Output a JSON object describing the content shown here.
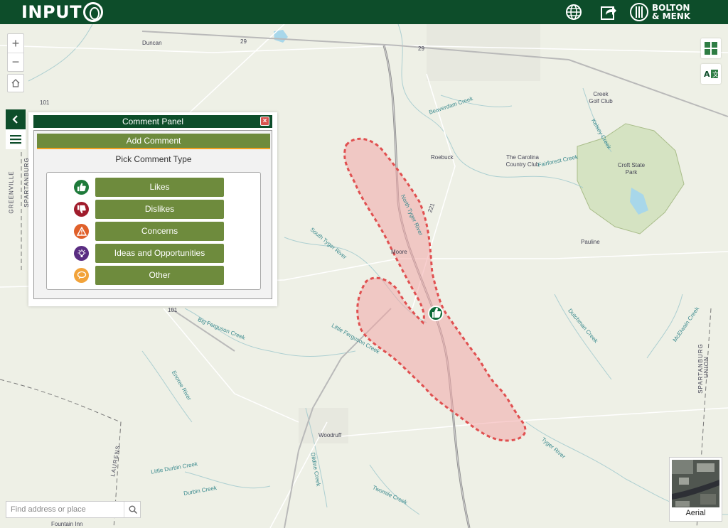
{
  "header": {
    "brand": "INPUT",
    "brand_suffix": "iD",
    "language_icon": "globe-icon",
    "share_icon": "share-icon",
    "company_line1": "BOLTON",
    "company_line2": "& MENK",
    "colors": {
      "header_bg": "#0d4d2a",
      "button_green": "#6e8b3d",
      "accent_orange": "#f0a020"
    }
  },
  "map": {
    "places": [
      {
        "label": "Duncan"
      },
      {
        "label": "Roebuck"
      },
      {
        "label": "The Carolina Country Club"
      },
      {
        "label": "Moore"
      },
      {
        "label": "Pauline"
      },
      {
        "label": "Woodruff"
      },
      {
        "label": "Croft State Park"
      },
      {
        "label": "Creek Golf Club"
      },
      {
        "label": "Fountain Inn"
      },
      {
        "label": "LAURENS"
      },
      {
        "label": "GREENVILLE"
      },
      {
        "label": "SPARTANBURG"
      },
      {
        "label": "SPARTANBURG"
      },
      {
        "label": "UNION"
      }
    ],
    "waters": [
      {
        "label": "Beaverdam Creek"
      },
      {
        "label": "Fairforest Creek"
      },
      {
        "label": "Kelsey Creek"
      },
      {
        "label": "North Tyger River"
      },
      {
        "label": "South Tyger River"
      },
      {
        "label": "Big Ferguson Creek"
      },
      {
        "label": "Little Ferguson Creek"
      },
      {
        "label": "Enoree River"
      },
      {
        "label": "Dutchman Creek"
      },
      {
        "label": "McElwain Creek"
      },
      {
        "label": "Tyger River"
      },
      {
        "label": "Little Durbin Creek"
      },
      {
        "label": "Durbin Creek"
      },
      {
        "label": "Dildine Creek"
      },
      {
        "label": "Twomile Creek"
      }
    ],
    "roads": [
      {
        "label": "29"
      },
      {
        "label": "29"
      },
      {
        "label": "101"
      },
      {
        "label": "101"
      },
      {
        "label": "221"
      }
    ],
    "marker_icon": "thumbs-up-icon"
  },
  "controls": {
    "zoom_in": "+",
    "zoom_out": "−",
    "home_icon": "home-icon",
    "collapse_icon": "chevron-left-icon",
    "menu_icon": "menu-icon",
    "basemap_gallery_icon": "grid-icon",
    "legend_icon": "legend-icon"
  },
  "panel": {
    "title": "Comment Panel",
    "close": "×",
    "add_comment": "Add Comment",
    "pick_type": "Pick Comment Type",
    "types": [
      {
        "label": "Likes",
        "icon": "thumbs-up-icon",
        "color": "#1e7a3a"
      },
      {
        "label": "Dislikes",
        "icon": "thumbs-down-icon",
        "color": "#a01c2c"
      },
      {
        "label": "Concerns",
        "icon": "warning-icon",
        "color": "#e0602a"
      },
      {
        "label": "Ideas and Opportunities",
        "icon": "lightbulb-icon",
        "color": "#5a2d82"
      },
      {
        "label": "Other",
        "icon": "speech-bubble-icon",
        "color": "#f2a33a"
      }
    ]
  },
  "search": {
    "placeholder": "Find address or place"
  },
  "basemap": {
    "label": "Aerial"
  }
}
